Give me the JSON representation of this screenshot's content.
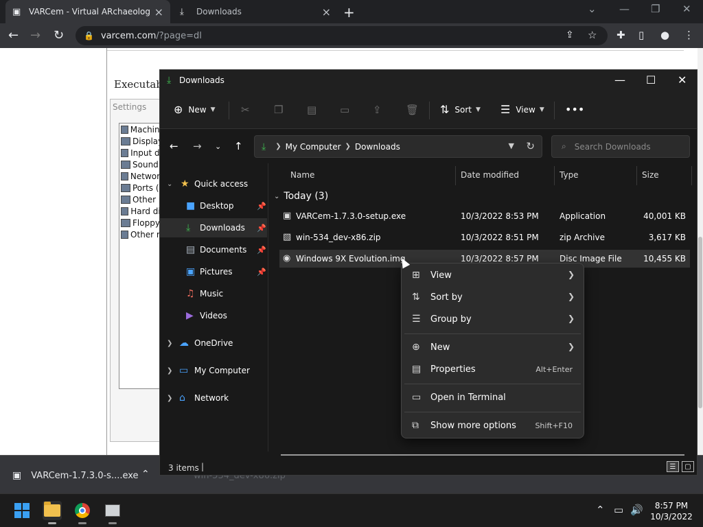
{
  "browser": {
    "tabs": [
      {
        "title": "VARCem - Virtual ARchaeological"
      },
      {
        "title": "Downloads"
      }
    ],
    "url_host": "varcem.com",
    "url_path": "/?page=dl"
  },
  "webpage": {
    "heading": "Executable",
    "settings_label": "Settings",
    "tree_items": [
      "Machine",
      "Display",
      "Input de",
      "Sound",
      "Network",
      "Ports (C",
      "Other p",
      "Hard dis",
      "Floppy",
      "Other re"
    ]
  },
  "download_bar": {
    "file": "VARCem-1.7.3.0-s....exe",
    "ghost": "win-534_dev-x86.zip"
  },
  "explorer": {
    "title": "Downloads",
    "toolbar": {
      "new": "New",
      "sort": "Sort",
      "view": "View"
    },
    "breadcrumb": [
      "My Computer",
      "Downloads"
    ],
    "search_placeholder": "Search Downloads",
    "nav": {
      "quick_access": "Quick access",
      "items": [
        "Desktop",
        "Downloads",
        "Documents",
        "Pictures",
        "Music",
        "Videos"
      ],
      "onedrive": "OneDrive",
      "my_computer": "My Computer",
      "network": "Network"
    },
    "columns": {
      "name": "Name",
      "date": "Date modified",
      "type": "Type",
      "size": "Size"
    },
    "group": "Today (3)",
    "files": [
      {
        "name": "VARCem-1.7.3.0-setup.exe",
        "date": "10/3/2022 8:53 PM",
        "type": "Application",
        "size": "40,001 KB"
      },
      {
        "name": "win-534_dev-x86.zip",
        "date": "10/3/2022 8:51 PM",
        "type": "zip Archive",
        "size": "3,617 KB"
      },
      {
        "name": "Windows 9X Evolution.img",
        "date": "10/3/2022 8:57 PM",
        "type": "Disc Image File",
        "size": "10,455 KB"
      }
    ],
    "status": "3 items"
  },
  "context_menu": {
    "view": "View",
    "sort_by": "Sort by",
    "group_by": "Group by",
    "new": "New",
    "properties": "Properties",
    "properties_shortcut": "Alt+Enter",
    "open_terminal": "Open in Terminal",
    "more_options": "Show more options",
    "more_options_shortcut": "Shift+F10"
  },
  "taskbar": {
    "time": "8:57 PM",
    "date": "10/3/2022"
  }
}
